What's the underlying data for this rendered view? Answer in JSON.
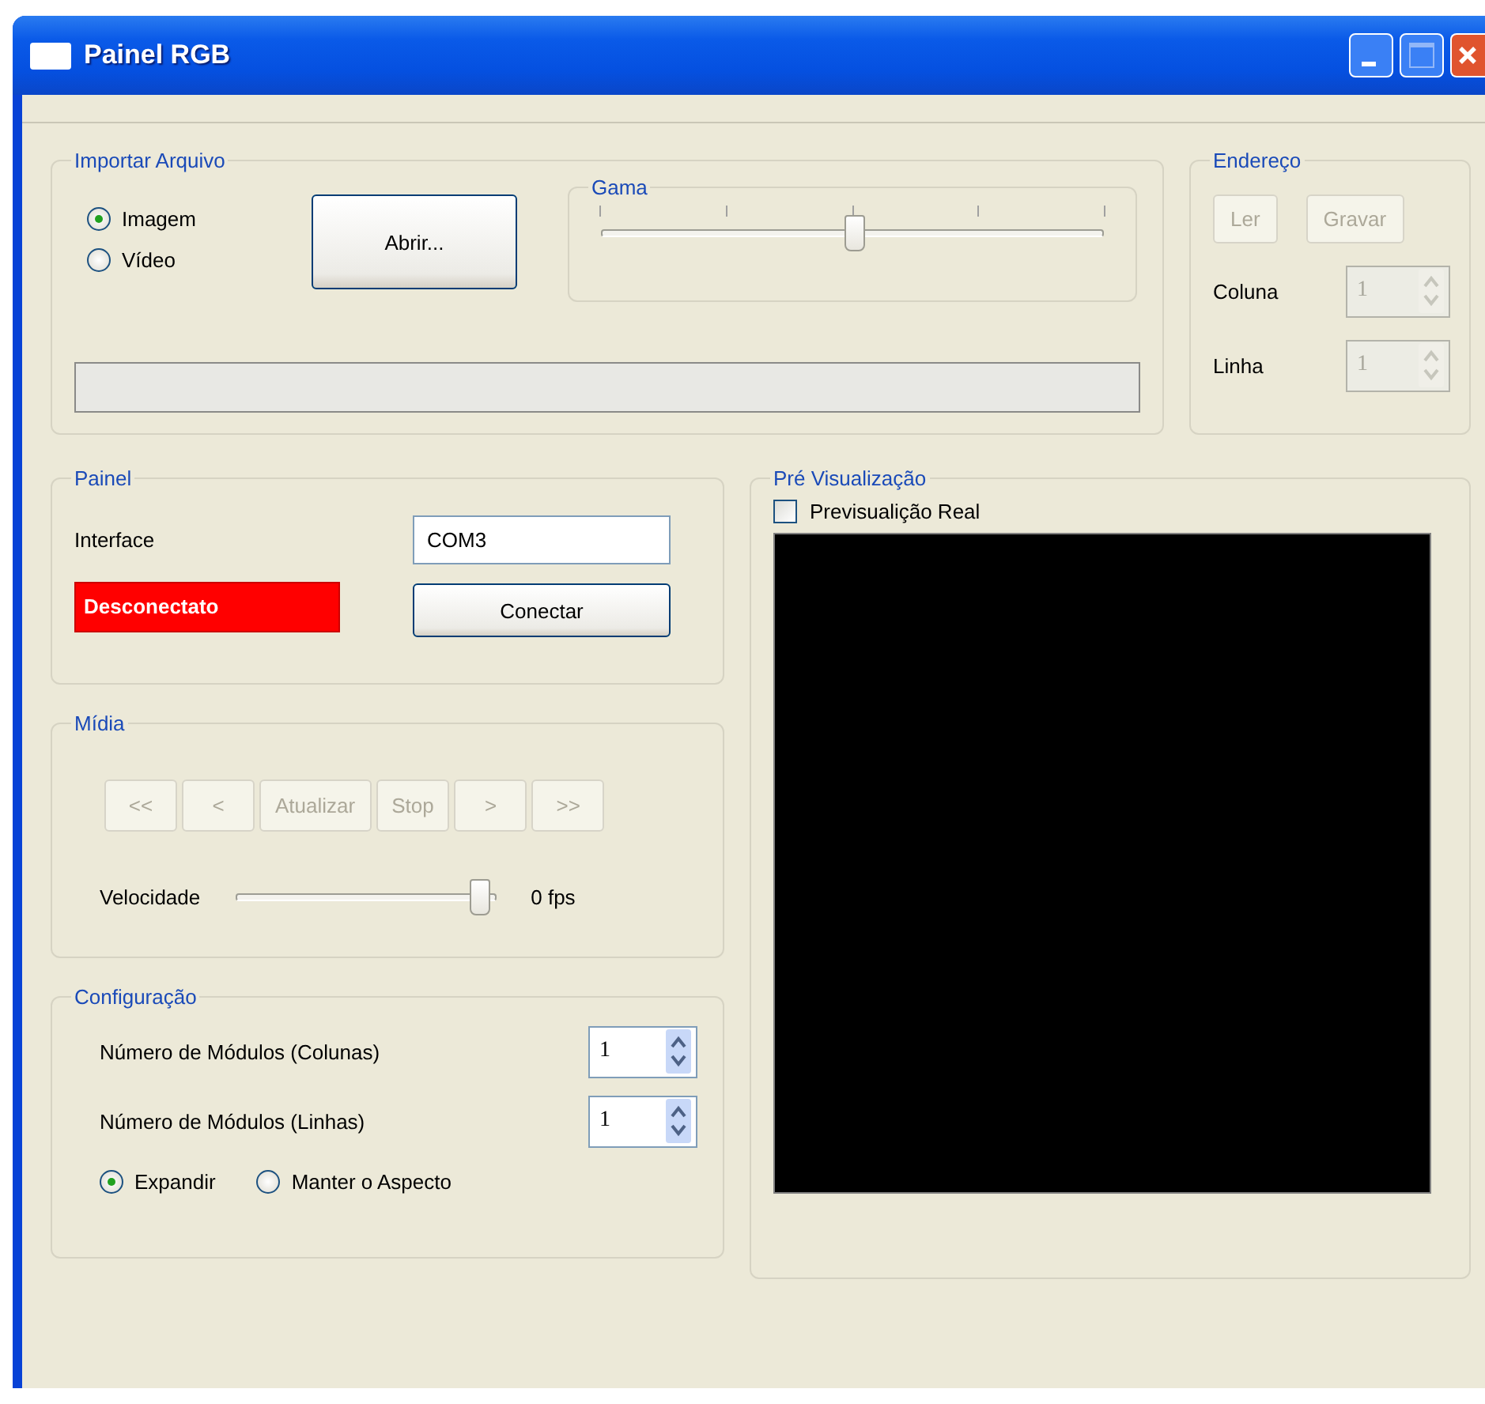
{
  "window": {
    "title": "Painel RGB"
  },
  "import_file": {
    "title": "Importar Arquivo",
    "options": [
      {
        "label": "Imagem",
        "selected": true
      },
      {
        "label": "Vídeo",
        "selected": false
      }
    ],
    "open_button": "Abrir...",
    "gamma": {
      "title": "Gama",
      "level": 0.5
    },
    "progress": {
      "level": 0
    }
  },
  "address": {
    "title": "Endereço",
    "buttons": [
      {
        "label": "Ler",
        "disabled": true
      },
      {
        "label": "Gravar",
        "disabled": true
      }
    ],
    "fields": [
      {
        "label": "Coluna",
        "value": "1",
        "disabled": true
      },
      {
        "label": "Linha",
        "value": "1",
        "disabled": true
      }
    ]
  },
  "panel": {
    "title": "Painel",
    "interface_label": "Interface",
    "interface_value": "COM3",
    "status": {
      "text": "Desconectato",
      "connected": false
    },
    "connect_button": "Conectar"
  },
  "media": {
    "title": "Mídia",
    "buttons": [
      {
        "label": "<<",
        "disabled": true
      },
      {
        "label": "<",
        "disabled": true
      },
      {
        "label": "Atualizar",
        "disabled": true
      },
      {
        "label": "Stop",
        "disabled": true
      },
      {
        "label": ">",
        "disabled": true
      },
      {
        "label": ">>",
        "disabled": true
      }
    ],
    "speed_label": "Velocidade",
    "speed": {
      "level": 0.9
    },
    "speed_reading": "0 fps"
  },
  "config": {
    "title": "Configuração",
    "fields": [
      {
        "label": "Número de Módulos (Colunas)",
        "value": "1",
        "disabled": false
      },
      {
        "label": "Número de Módulos (Linhas)",
        "value": "1",
        "disabled": false
      }
    ],
    "options": [
      {
        "label": "Expandir",
        "selected": true
      },
      {
        "label": "Manter o Aspecto",
        "selected": false
      }
    ]
  },
  "preview": {
    "title": "Pré Visualização",
    "checkbox": {
      "label": "Previsualição Real",
      "checked": false
    }
  }
}
